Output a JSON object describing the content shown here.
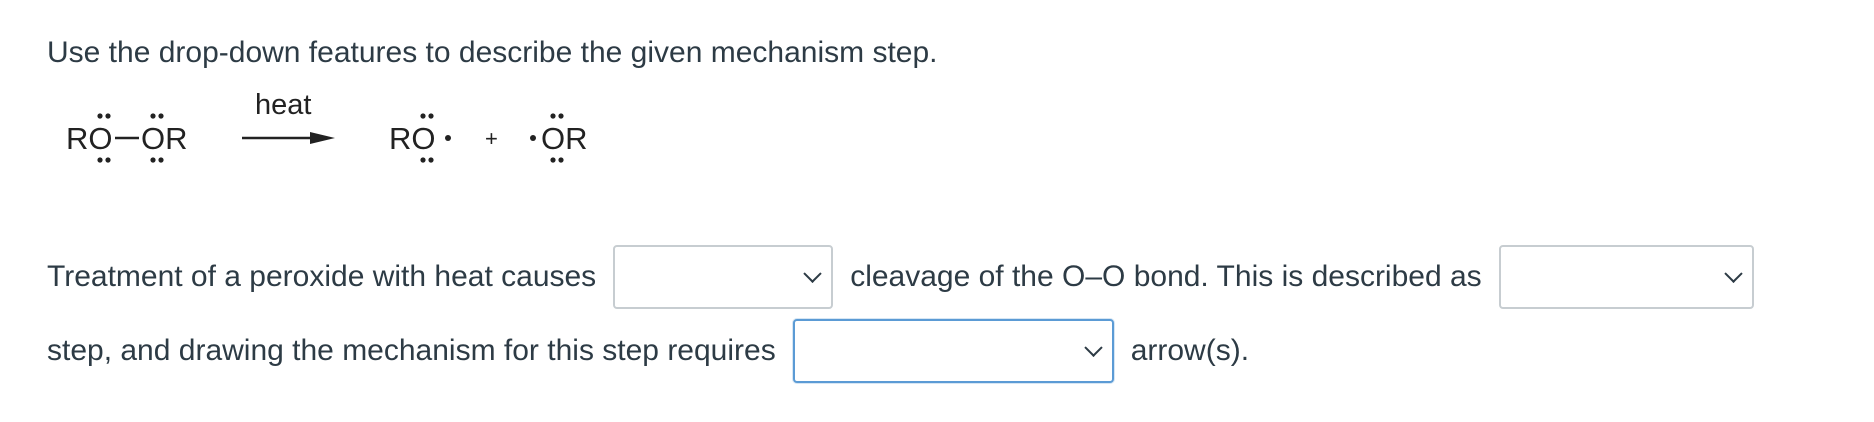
{
  "question": {
    "instruction": "Use the drop-down features to describe the given mechanism step."
  },
  "scheme": {
    "reactant_left": "RO",
    "reactant_right": "OR",
    "condition": "heat",
    "product1": "RO",
    "plus": "+",
    "product2": "OR"
  },
  "sentence": {
    "part1": "Treatment of a peroxide with heat causes",
    "part2": "cleavage of the O–O bond. This is described as",
    "part3": "step, and drawing the mechanism for this step requires",
    "part4": "arrow(s)."
  },
  "dropdowns": {
    "cleavage_type": {
      "value": ""
    },
    "step_type": {
      "value": ""
    },
    "arrow_type": {
      "value": ""
    }
  }
}
